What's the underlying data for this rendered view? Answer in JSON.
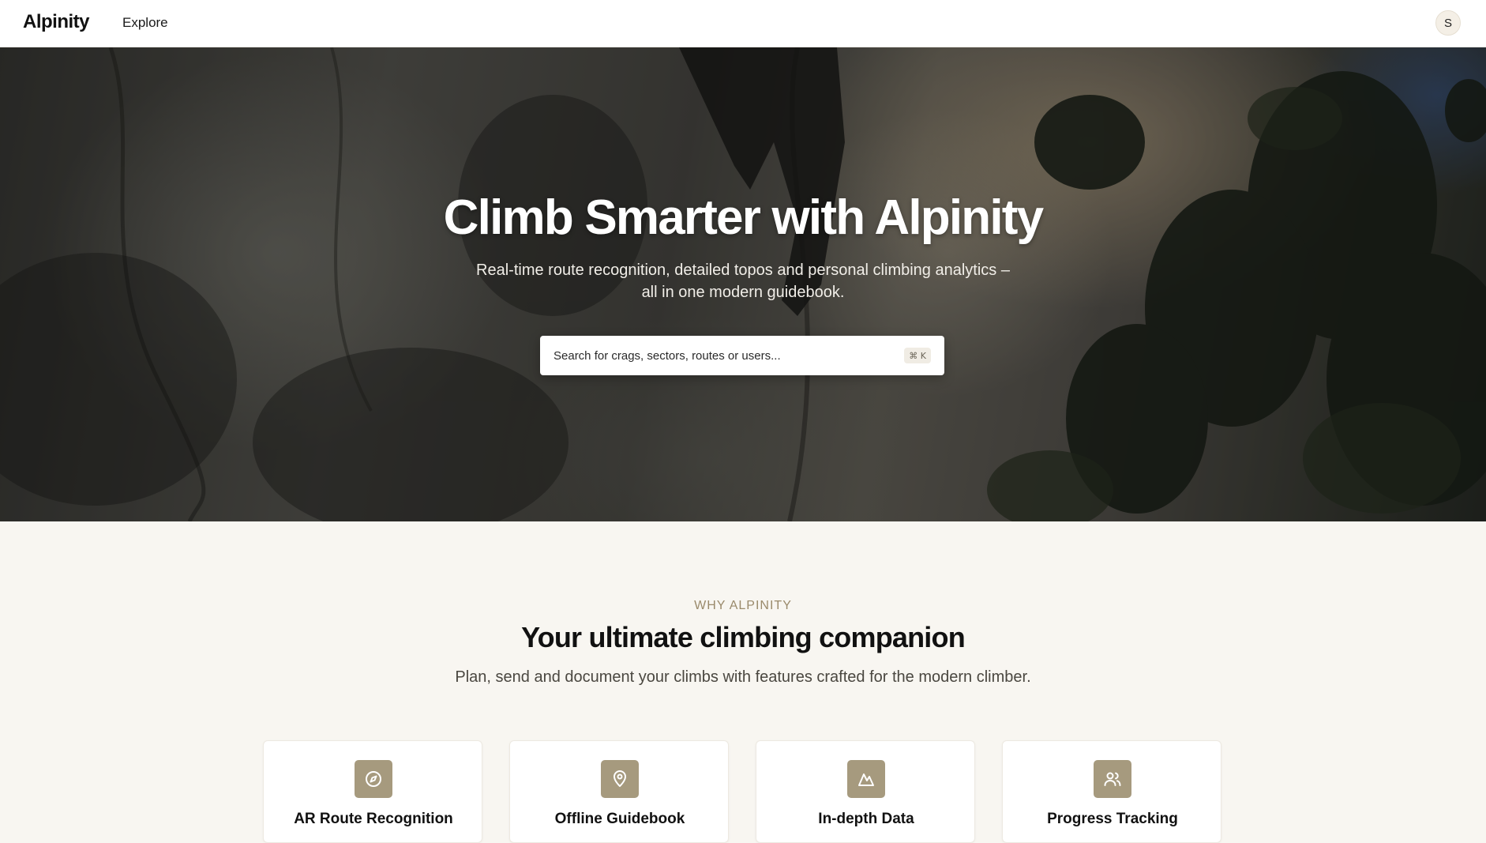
{
  "nav": {
    "brand": "Alpinity",
    "links": [
      {
        "label": "Explore"
      }
    ],
    "avatar_initial": "S"
  },
  "hero": {
    "title": "Climb Smarter with Alpinity",
    "subtitle": "Real-time route recognition, detailed topos and personal climbing analytics – all in one modern guidebook.",
    "search": {
      "placeholder": "Search for crags, sectors, routes or users...",
      "shortcut": "⌘ K"
    }
  },
  "why": {
    "eyebrow": "WHY ALPINITY",
    "title": "Your ultimate climbing companion",
    "subtitle": "Plan, send and document your climbs with features crafted for the modern climber.",
    "features": [
      {
        "icon": "compass-icon",
        "title": "AR Route Recognition"
      },
      {
        "icon": "map-pin-icon",
        "title": "Offline Guidebook"
      },
      {
        "icon": "mountain-icon",
        "title": "In-depth Data"
      },
      {
        "icon": "users-icon",
        "title": "Progress Tracking"
      }
    ]
  },
  "colors": {
    "accent": "#a69a7e",
    "eyebrow": "#9a8a6b",
    "section_bg": "#f8f6f1"
  }
}
